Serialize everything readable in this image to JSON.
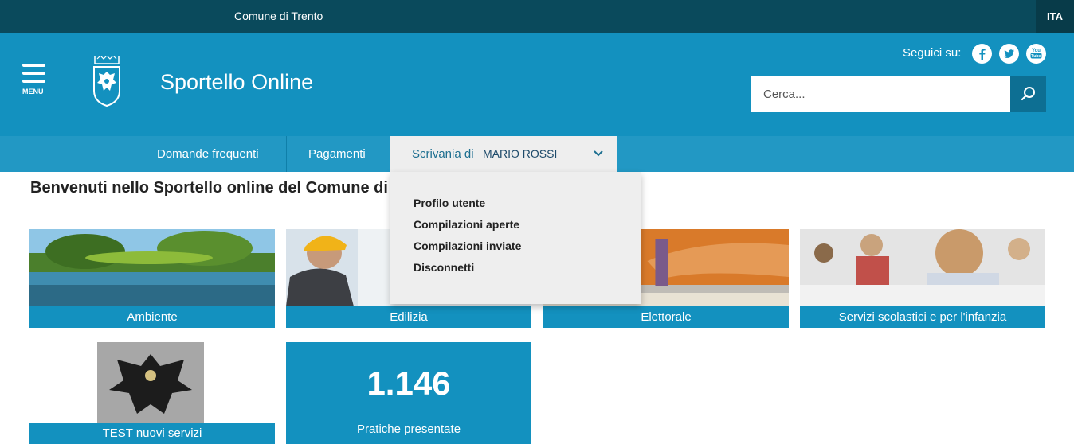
{
  "topbar": {
    "org": "Comune di Trento",
    "lang": "ITA"
  },
  "header": {
    "menu_label": "MENU",
    "site_title": "Sportello Online",
    "follow_label": "Seguici su:",
    "social": [
      {
        "name": "facebook-icon",
        "glyph": "f"
      },
      {
        "name": "twitter-icon",
        "glyph": "t"
      },
      {
        "name": "youtube-icon",
        "glyph": "You\nTube"
      }
    ],
    "search": {
      "placeholder": "Cerca..."
    }
  },
  "nav": {
    "items": [
      {
        "label": "Domande frequenti"
      },
      {
        "label": "Pagamenti"
      }
    ],
    "desk": {
      "label": "Scrivania di",
      "user": "MARIO ROSSI"
    }
  },
  "dropdown": {
    "items": [
      {
        "label": "Profilo utente"
      },
      {
        "label": "Compilazioni aperte"
      },
      {
        "label": "Compilazioni inviate"
      },
      {
        "label": "Disconnetti"
      }
    ]
  },
  "main": {
    "heading": "Benvenuti nello Sportello online del Comune di Trento",
    "tiles": [
      {
        "label": "Ambiente"
      },
      {
        "label": "Edilizia"
      },
      {
        "label": "Elettorale"
      },
      {
        "label": "Servizi scolastici e per l'infanzia"
      },
      {
        "label": "TEST nuovi servizi"
      }
    ],
    "stat": {
      "value": "1.146",
      "label": "Pratiche presentate"
    }
  },
  "colors": {
    "primary": "#1391bf",
    "topbar": "#0a4a5c",
    "nav": "#2298c4",
    "dropdown": "#eeeeee"
  }
}
